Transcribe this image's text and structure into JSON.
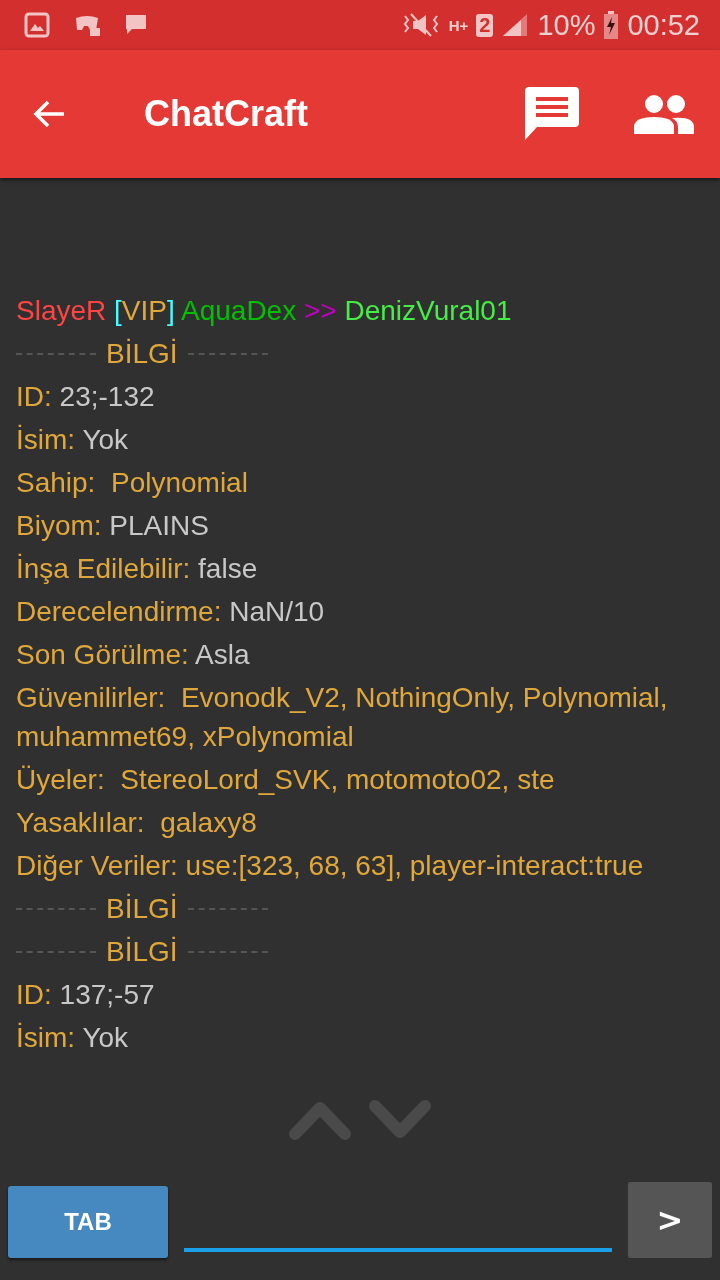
{
  "status_bar": {
    "network_type": "H+",
    "sim_slot": "2",
    "battery": "10%",
    "time": "00:52"
  },
  "toolbar": {
    "title": "ChatCraft"
  },
  "chat": [
    {
      "kind": "text",
      "segments": [
        {
          "text": "SlayeR ",
          "color": "#ff4444"
        },
        {
          "text": "[",
          "color": "#44ffff"
        },
        {
          "text": "VIP",
          "color": "#e0a83a"
        },
        {
          "text": "] ",
          "color": "#44ffff"
        },
        {
          "text": "AquaDex ",
          "color": "#00c000"
        },
        {
          "text": ">> ",
          "color": "#c000c0"
        },
        {
          "text": "DenizVural01",
          "color": "#44ee44"
        }
      ]
    },
    {
      "kind": "divider",
      "segments": [
        {
          "text": "BİLGİ",
          "color": "#e0a83a"
        }
      ]
    },
    {
      "kind": "text",
      "segments": [
        {
          "text": "ID: ",
          "color": "#e0a83a"
        },
        {
          "text": "23;-132",
          "color": "#c8c8c8"
        }
      ]
    },
    {
      "kind": "text",
      "segments": [
        {
          "text": "İsim: ",
          "color": "#e0a83a"
        },
        {
          "text": "Yok",
          "color": "#c8c8c8"
        }
      ]
    },
    {
      "kind": "text",
      "segments": [
        {
          "text": "Sahip:  Polynomial",
          "color": "#e0a83a"
        }
      ]
    },
    {
      "kind": "text",
      "segments": [
        {
          "text": "Biyom: ",
          "color": "#e0a83a"
        },
        {
          "text": "PLAINS",
          "color": "#c8c8c8"
        }
      ]
    },
    {
      "kind": "text",
      "segments": [
        {
          "text": "İnşa Edilebilir: ",
          "color": "#e0a83a"
        },
        {
          "text": "false",
          "color": "#c8c8c8"
        }
      ]
    },
    {
      "kind": "text",
      "segments": [
        {
          "text": "Derecelendirme: ",
          "color": "#e0a83a"
        },
        {
          "text": "NaN/10",
          "color": "#c8c8c8"
        }
      ]
    },
    {
      "kind": "text",
      "segments": [
        {
          "text": "Son Görülme: ",
          "color": "#e0a83a"
        },
        {
          "text": "Asla",
          "color": "#c8c8c8"
        }
      ]
    },
    {
      "kind": "text",
      "segments": [
        {
          "text": "Güvenilirler:  Evonodk_V2, NothingOnly, Polynomial, muhammet69, xPolynomial",
          "color": "#e0a83a"
        }
      ]
    },
    {
      "kind": "text",
      "segments": [
        {
          "text": "Üyeler:  StereoLord_SVK, motomoto02, ste",
          "color": "#e0a83a"
        }
      ]
    },
    {
      "kind": "text",
      "segments": [
        {
          "text": "Yasaklılar:  galaxy8",
          "color": "#e0a83a"
        }
      ]
    },
    {
      "kind": "text",
      "segments": [
        {
          "text": "Diğer Veriler: use:[323, 68, 63], player-interact:true",
          "color": "#e0a83a"
        }
      ]
    },
    {
      "kind": "divider",
      "segments": [
        {
          "text": "BİLGİ",
          "color": "#e0a83a"
        }
      ]
    },
    {
      "kind": "divider",
      "segments": [
        {
          "text": "BİLGİ",
          "color": "#e0a83a"
        }
      ]
    },
    {
      "kind": "text",
      "segments": [
        {
          "text": "ID: ",
          "color": "#e0a83a"
        },
        {
          "text": "137;-57",
          "color": "#c8c8c8"
        }
      ]
    },
    {
      "kind": "text",
      "segments": [
        {
          "text": "İsim: ",
          "color": "#e0a83a"
        },
        {
          "text": "Yok",
          "color": "#c8c8c8"
        }
      ]
    }
  ],
  "input_bar": {
    "tab_button": "TAB",
    "send_button": ">"
  }
}
